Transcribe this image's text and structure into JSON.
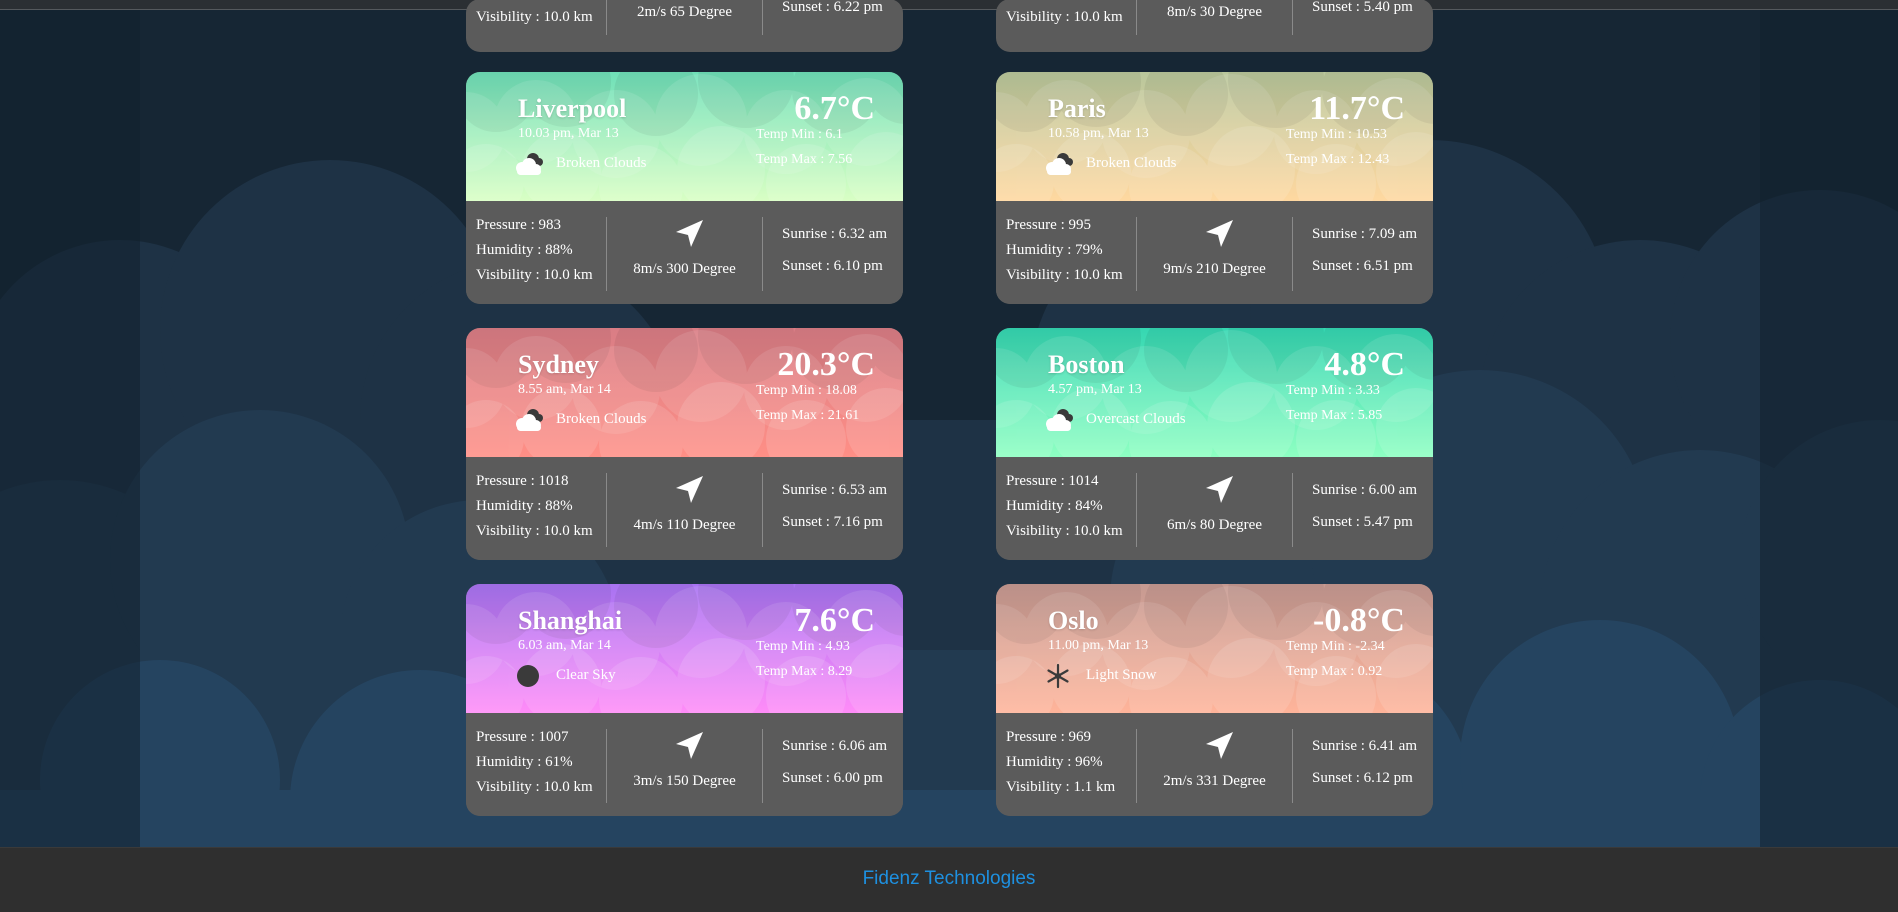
{
  "colors": {
    "page_bg": "#13212d",
    "card_bottom": "#5b5b5b",
    "footer_bg": "#2f2f2f",
    "footer_text": "#1e90e0"
  },
  "partial_cards": [
    {
      "visibility": "Visibility : 10.0 km",
      "wind": "2m/s 65 Degree",
      "sunset": "Sunset : 6.22 pm"
    },
    {
      "visibility": "Visibility : 10.0 km",
      "wind": "8m/s 30 Degree",
      "sunset": "Sunset : 5.40 pm"
    }
  ],
  "cards": [
    {
      "city": "Liverpool",
      "datetime": "10.03 pm, Mar 13",
      "condition": "Broken Clouds",
      "icon": "cloud-icon",
      "temp": "6.7°C",
      "temp_min": "Temp Min : 6.1",
      "temp_max": "Temp Max : 7.56",
      "pressure": "Pressure : 983",
      "humidity": "Humidity : 88%",
      "visibility": "Visibility : 10.0 km",
      "wind": "8m/s 300 Degree",
      "sunrise": "Sunrise : 6.32 am",
      "sunset": "Sunset : 6.10 pm",
      "gradient": [
        "#6fe0b8",
        "#d9ffc4"
      ]
    },
    {
      "city": "Paris",
      "datetime": "10.58 pm, Mar 13",
      "condition": "Broken Clouds",
      "icon": "cloud-icon",
      "temp": "11.7°C",
      "temp_min": "Temp Min : 10.53",
      "temp_max": "Temp Max : 12.43",
      "pressure": "Pressure : 995",
      "humidity": "Humidity : 79%",
      "visibility": "Visibility : 10.0 km",
      "wind": "9m/s 210 Degree",
      "sunrise": "Sunrise : 7.09 am",
      "sunset": "Sunset : 6.51 pm",
      "gradient": [
        "#b9c79c",
        "#ffd8a0"
      ]
    },
    {
      "city": "Sydney",
      "datetime": "8.55 am, Mar 14",
      "condition": "Broken Clouds",
      "icon": "cloud-icon",
      "temp": "20.3°C",
      "temp_min": "Temp Min : 18.08",
      "temp_max": "Temp Max : 21.61",
      "pressure": "Pressure : 1018",
      "humidity": "Humidity : 88%",
      "visibility": "Visibility : 10.0 km",
      "wind": "4m/s 110 Degree",
      "sunrise": "Sunrise : 6.53 am",
      "sunset": "Sunset : 7.16 pm",
      "gradient": [
        "#d97d85",
        "#ff8f86"
      ]
    },
    {
      "city": "Boston",
      "datetime": "4.57 pm, Mar 13",
      "condition": "Overcast Clouds",
      "icon": "cloud-icon",
      "temp": "4.8°C",
      "temp_min": "Temp Min : 3.33",
      "temp_max": "Temp Max : 5.85",
      "pressure": "Pressure : 1014",
      "humidity": "Humidity : 84%",
      "visibility": "Visibility : 10.0 km",
      "wind": "6m/s 80 Degree",
      "sunrise": "Sunrise : 6.00 am",
      "sunset": "Sunset : 5.47 pm",
      "gradient": [
        "#35d7b2",
        "#8effc2"
      ]
    },
    {
      "city": "Shanghai",
      "datetime": "6.03 am, Mar 14",
      "condition": "Clear Sky",
      "icon": "sun-icon",
      "temp": "7.6°C",
      "temp_min": "Temp Min : 4.93",
      "temp_max": "Temp Max : 8.29",
      "pressure": "Pressure : 1007",
      "humidity": "Humidity : 61%",
      "visibility": "Visibility : 10.0 km",
      "wind": "3m/s 150 Degree",
      "sunrise": "Sunrise : 6.06 am",
      "sunset": "Sunset : 6.00 pm",
      "gradient": [
        "#a873f2",
        "#ff8cf8"
      ]
    },
    {
      "city": "Oslo",
      "datetime": "11.00 pm, Mar 13",
      "condition": "Light Snow",
      "icon": "snowflake-icon",
      "temp": "-0.8°C",
      "temp_min": "Temp Min : -2.34",
      "temp_max": "Temp Max : 0.92",
      "pressure": "Pressure : 969",
      "humidity": "Humidity : 96%",
      "visibility": "Visibility : 1.1 km",
      "wind": "2m/s 331 Degree",
      "sunrise": "Sunrise : 6.41 am",
      "sunset": "Sunset : 6.12 pm",
      "gradient": [
        "#c69a92",
        "#ffb49a"
      ]
    }
  ],
  "footer": {
    "text": "Fidenz Technologies"
  }
}
